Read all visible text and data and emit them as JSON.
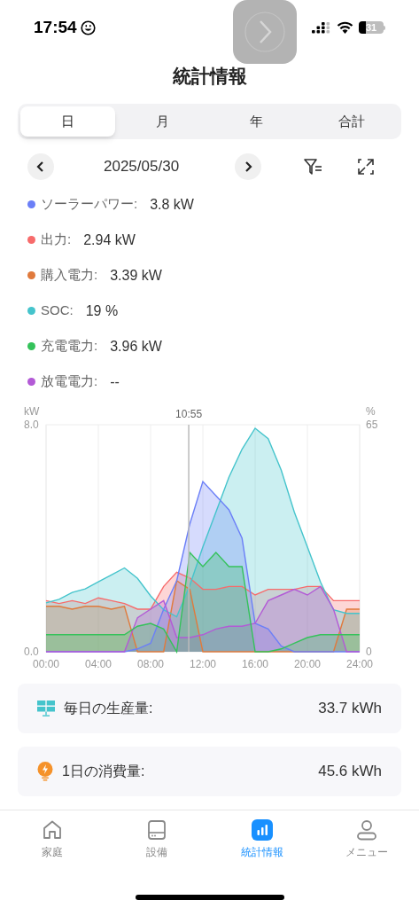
{
  "status_bar": {
    "time": "17:54",
    "battery": "31"
  },
  "title": "統計情報",
  "tabs": [
    {
      "label": "日",
      "selected": true
    },
    {
      "label": "月",
      "selected": false
    },
    {
      "label": "年",
      "selected": false
    },
    {
      "label": "合計",
      "selected": false
    }
  ],
  "date": "2025/05/30",
  "legend": [
    {
      "label": "ソーラーパワー:",
      "value": "3.8 kW",
      "color": "#6b7ff7"
    },
    {
      "label": "出力:",
      "value": "2.94 kW",
      "color": "#f76b6b"
    },
    {
      "label": "購入電力:",
      "value": "3.39 kW",
      "color": "#e07a3c"
    },
    {
      "label": "SOC:",
      "value": "19 %",
      "color": "#45c4cc"
    },
    {
      "label": "充電電力:",
      "value": "3.96 kW",
      "color": "#34c25a"
    },
    {
      "label": "放電電力:",
      "value": "--",
      "color": "#b35ad6"
    }
  ],
  "chart_data": {
    "type": "area",
    "ylabel": "kW",
    "y2label": "%",
    "x": [
      0,
      1,
      2,
      3,
      4,
      5,
      6,
      7,
      8,
      9,
      10,
      11,
      12,
      13,
      14,
      15,
      16,
      17,
      18,
      19,
      20,
      21,
      22,
      23,
      24
    ],
    "grid": true,
    "xlim": [
      0,
      24
    ],
    "ylim": [
      0,
      8
    ],
    "y2lim": [
      0,
      65
    ],
    "xticks": [
      {
        "value": 0,
        "label": "00:00"
      },
      {
        "value": 4,
        "label": "04:00"
      },
      {
        "value": 8,
        "label": "08:00"
      },
      {
        "value": 12,
        "label": "12:00"
      },
      {
        "value": 16,
        "label": "16:00"
      },
      {
        "value": 20,
        "label": "20:00"
      },
      {
        "value": 24,
        "label": "24:00"
      }
    ],
    "yticks": [
      {
        "value": 0,
        "label": "0.0"
      },
      {
        "value": 8,
        "label": "8.0"
      }
    ],
    "y2ticks": [
      {
        "value": 0,
        "label": "0"
      },
      {
        "value": 65,
        "label": "65"
      }
    ],
    "series": [
      {
        "color": "#f76b6b",
        "values": [
          1.8,
          1.7,
          1.8,
          1.7,
          1.9,
          1.8,
          1.7,
          1.5,
          1.5,
          2.3,
          2.8,
          2.6,
          2.2,
          2.2,
          2.3,
          2.3,
          2.0,
          2.2,
          2.2,
          2.2,
          2.3,
          2.3,
          1.8,
          1.8,
          1.8
        ]
      },
      {
        "color": "#e07a3c",
        "values": [
          1.6,
          1.6,
          1.5,
          1.6,
          1.6,
          1.5,
          1.6,
          0,
          0,
          0,
          2.5,
          2.2,
          0,
          0,
          0,
          0,
          0,
          0,
          0,
          0,
          0,
          0,
          0,
          1.5,
          1.5
        ]
      },
      {
        "color": "#45c4cc",
        "axis": "y2",
        "values": [
          14,
          15,
          17,
          18,
          20,
          22,
          24,
          21,
          16,
          12,
          10,
          19,
          30,
          40,
          50,
          58,
          64,
          61,
          52,
          40,
          30,
          20,
          12,
          11,
          11
        ]
      },
      {
        "color": "#6b7ff7",
        "values": [
          0,
          0,
          0,
          0,
          0,
          0,
          0,
          0.1,
          0.3,
          1.5,
          2.5,
          4.5,
          6.0,
          5.5,
          5.0,
          4.0,
          1.0,
          0.8,
          0.2,
          0,
          0,
          0,
          0,
          0,
          0
        ]
      },
      {
        "color": "#b35ad6",
        "values": [
          0,
          0,
          0,
          0,
          0,
          0,
          0,
          1.2,
          1.5,
          1.8,
          0.5,
          0.5,
          0.6,
          0.8,
          0.9,
          0.9,
          1.0,
          1.8,
          2.0,
          2.2,
          2.0,
          2.3,
          1.5,
          0,
          0
        ]
      },
      {
        "color": "#34c25a",
        "values": [
          0.6,
          0.6,
          0.6,
          0.6,
          0.6,
          0.6,
          0.6,
          0.9,
          1.0,
          0.8,
          0,
          3.5,
          3.0,
          3.5,
          3.0,
          3.0,
          0,
          0,
          0.1,
          0.3,
          0.5,
          0.6,
          0.6,
          0.6,
          0.6
        ]
      }
    ],
    "annotations": [
      {
        "x": 10.92,
        "text": "10:55"
      }
    ]
  },
  "summary": [
    {
      "kind": "production",
      "label": "毎日の生産量:",
      "value": "33.7 kWh"
    },
    {
      "kind": "consumption",
      "label": "1日の消費量:",
      "value": "45.6 kWh"
    }
  ],
  "nav": [
    {
      "kind": "home",
      "label": "家庭",
      "selected": false
    },
    {
      "kind": "device",
      "label": "設備",
      "selected": false
    },
    {
      "kind": "stats",
      "label": "統計情報",
      "selected": true
    },
    {
      "kind": "menu",
      "label": "メニュー",
      "selected": false
    }
  ]
}
